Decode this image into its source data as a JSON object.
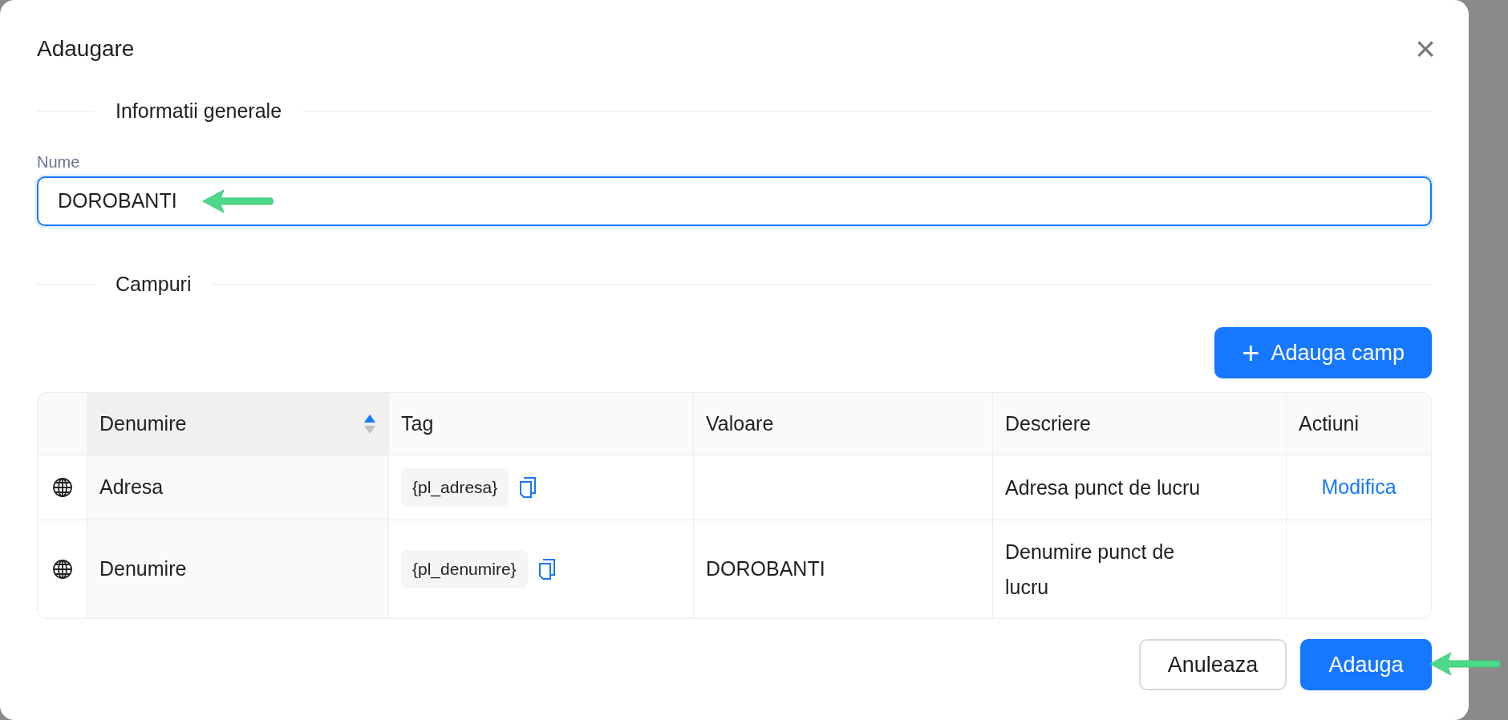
{
  "dialog": {
    "title": "Adaugare",
    "close": "×"
  },
  "sections": [
    {
      "title": "Informatii generale"
    },
    {
      "title": "Campuri"
    }
  ],
  "name_field": {
    "label": "Nume",
    "value": "DOROBANTI",
    "focused": true
  },
  "add_field_button": {
    "icon": "+",
    "label": "Adauga camp"
  },
  "table": {
    "columns": [
      {
        "label": "Denumire",
        "sorted": true
      },
      {
        "label": "Tag"
      },
      {
        "label": "Valoare"
      },
      {
        "label": "Descriere"
      },
      {
        "label": "Actiuni"
      }
    ],
    "rows": [
      {
        "name": "Adresa",
        "tag": "{pl_adresa}",
        "value": "",
        "description": "Adresa punct de lucru",
        "action": "Modifica"
      },
      {
        "name": "Denumire",
        "tag": "{pl_denumire}",
        "value": "DOROBANTI",
        "description": "Denumire punct de lucru",
        "action": ""
      }
    ]
  },
  "footer": {
    "cancel": "Anuleaza",
    "submit": "Adauga"
  }
}
